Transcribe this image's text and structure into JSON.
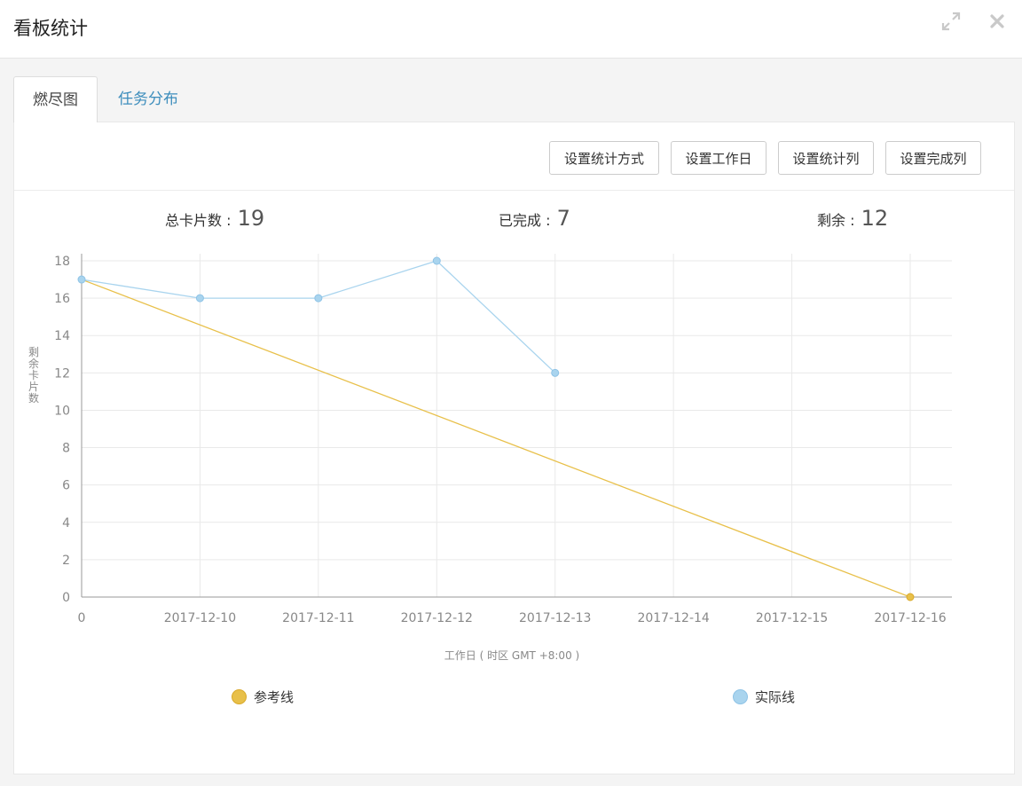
{
  "window": {
    "title": "看板统计",
    "expand_icon": "expand-icon",
    "close_icon": "close-icon"
  },
  "tabs": [
    {
      "label": "燃尽图",
      "active": true
    },
    {
      "label": "任务分布",
      "active": false
    }
  ],
  "toolbar": {
    "buttons": [
      "设置统计方式",
      "设置工作日",
      "设置统计列",
      "设置完成列"
    ]
  },
  "stats": {
    "total_label": "总卡片数 :",
    "total_value": "19",
    "done_label": "已完成 :",
    "done_value": "7",
    "remaining_label": "剩余 :",
    "remaining_value": "12"
  },
  "colors": {
    "reference": "#e8c04a",
    "actual": "#a9d4ee",
    "link": "#3c8dbc"
  },
  "chart_data": {
    "type": "line",
    "categories": [
      "0",
      "2017-12-10",
      "2017-12-11",
      "2017-12-12",
      "2017-12-13",
      "2017-12-14",
      "2017-12-15",
      "2017-12-16"
    ],
    "series": [
      {
        "name": "参考线",
        "values": [
          17,
          null,
          null,
          null,
          null,
          null,
          null,
          0
        ],
        "color": "#e8c04a"
      },
      {
        "name": "实际线",
        "values": [
          17,
          16,
          16,
          18,
          12,
          null,
          null,
          null
        ],
        "color": "#a9d4ee"
      }
    ],
    "xlabel": "工作日 ( 时区 GMT +8:00 )",
    "ylabel": "剩余卡片数",
    "ylim": [
      0,
      18
    ],
    "yticks": [
      0,
      2,
      4,
      6,
      8,
      10,
      12,
      14,
      16,
      18
    ],
    "grid": true,
    "legend": "bottom"
  }
}
